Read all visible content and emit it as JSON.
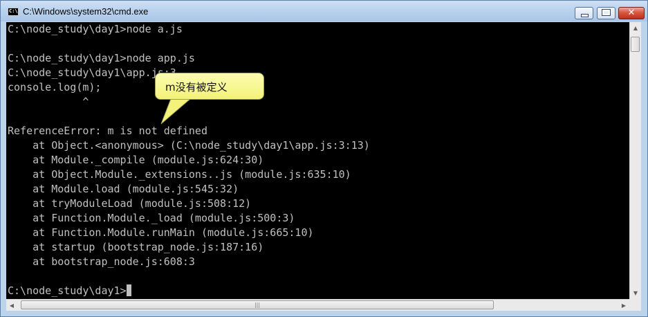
{
  "window": {
    "title": "C:\\Windows\\system32\\cmd.exe",
    "icon": "cmd-icon",
    "icon_text": "C:\\",
    "controls": {
      "minimize": "minimize-icon",
      "maximize": "maximize-icon",
      "close": "close-icon",
      "close_glyph": "✕"
    }
  },
  "console": {
    "lines": [
      "C:\\node_study\\day1>node a.js",
      "",
      "C:\\node_study\\day1>node app.js",
      "C:\\node_study\\day1\\app.js:3",
      "console.log(m);",
      "            ^",
      "",
      "ReferenceError: m is not defined",
      "    at Object.<anonymous> (C:\\node_study\\day1\\app.js:3:13)",
      "    at Module._compile (module.js:624:30)",
      "    at Object.Module._extensions..js (module.js:635:10)",
      "    at Module.load (module.js:545:32)",
      "    at tryModuleLoad (module.js:508:12)",
      "    at Function.Module._load (module.js:500:3)",
      "    at Function.Module.runMain (module.js:665:10)",
      "    at startup (bootstrap_node.js:187:16)",
      "    at bootstrap_node.js:608:3",
      ""
    ],
    "prompt": "C:\\node_study\\day1>",
    "text_color": "#c0c0c0",
    "background": "#000000"
  },
  "tooltip": {
    "text": "m没有被定义",
    "background": "#f6f48a"
  },
  "scrollbars": {
    "up_arrow": "▲",
    "down_arrow": "▼",
    "left_arrow": "◀",
    "right_arrow": "▶",
    "grip": "|||"
  }
}
